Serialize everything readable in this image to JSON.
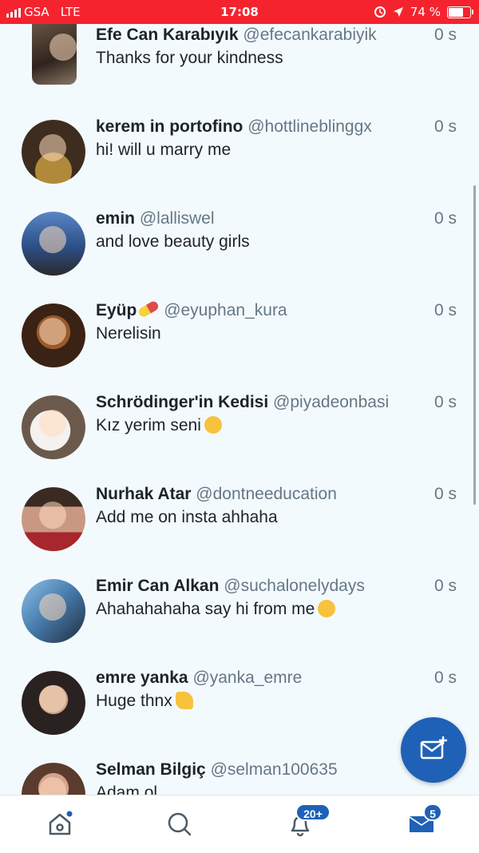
{
  "status_bar": {
    "carrier": "GSA",
    "network": "LTE",
    "time": "17:08",
    "battery": "74 %",
    "battery_level": 0.74,
    "background_color": "#f5232e"
  },
  "messages": [
    {
      "name": "Efe Can Karabıyık",
      "handle": "@efecankarabiyik",
      "time": "0 s",
      "text": "Thanks for your kindness",
      "emoji": ""
    },
    {
      "name": "kerem in portofino",
      "handle": "@hottlineblinggx",
      "time": "0 s",
      "text": "hi! will u marry me",
      "emoji": ""
    },
    {
      "name": "emin",
      "handle": "@lalliswel",
      "time": "0 s",
      "text": "and love beauty girls",
      "emoji": ""
    },
    {
      "name": "Eyüp",
      "handle": "@eyuphan_kura",
      "time": "0 s",
      "text": "Nerelisin",
      "emoji": "pill-icon"
    },
    {
      "name": "Schrödinger'in Kedisi",
      "handle": "@piyadeonbasi",
      "time": "0 s",
      "text": "Kız yerim seni",
      "emoji": "smirk-face-icon"
    },
    {
      "name": "Nurhak Atar",
      "handle": "@dontneeducation",
      "time": "0 s",
      "text": "Add me on insta ahhaha",
      "emoji": ""
    },
    {
      "name": "Emir Can Alkan",
      "handle": "@suchalonelydays",
      "time": "0 s",
      "text": "Ahahahahaha say hi from me",
      "emoji": "laughing-face-icon"
    },
    {
      "name": "emre yanka",
      "handle": "@yanka_emre",
      "time": "0 s",
      "text": "Huge thnx",
      "emoji": "thumbs-up-icon"
    },
    {
      "name": "Selman Bilgiç",
      "handle": "@selman100635",
      "time": "",
      "text": "Adam ol",
      "emoji": ""
    }
  ],
  "fab": {
    "icon": "new-message-icon"
  },
  "bottom_nav": {
    "home_icon": "home-icon",
    "search_icon": "search-icon",
    "notifications_icon": "bell-icon",
    "notifications_badge": "20+",
    "messages_icon": "envelope-icon",
    "messages_badge": "5"
  },
  "colors": {
    "accent": "#1f61b7",
    "background": "#f3fafd",
    "handle": "#657786"
  }
}
